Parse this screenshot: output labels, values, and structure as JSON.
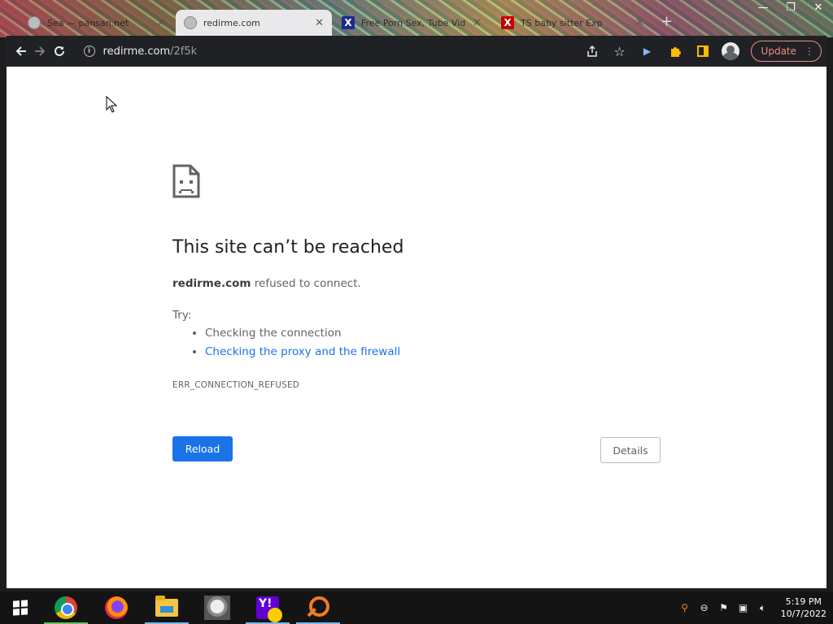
{
  "tabs": [
    {
      "label": "Sea — pansan.net",
      "active": false,
      "favicon": "globe-icon"
    },
    {
      "label": "redirme.com",
      "active": true,
      "favicon": "globe-icon"
    },
    {
      "label": "Free Porn Sex, Tube Vid",
      "active": false,
      "favicon": "x-site-icon",
      "favicon_color": "#1b2a8e"
    },
    {
      "label": "TS baby sitter Exp",
      "active": false,
      "favicon": "x-site-icon",
      "favicon_color": "#c40000"
    }
  ],
  "toolbar": {
    "address_domain": "redirme.com",
    "address_path": "/2f5k",
    "update_label": "Update"
  },
  "error": {
    "title": "This site can’t be reached",
    "host": "redirme.com",
    "description_suffix": " refused to connect.",
    "try_label": "Try:",
    "suggestions": [
      "Checking the connection",
      "Checking the proxy and the firewall"
    ],
    "code": "ERR_CONNECTION_REFUSED",
    "reload_label": "Reload",
    "details_label": "Details"
  },
  "taskbar": {
    "apps": [
      "chrome-icon",
      "firefox-icon",
      "file-explorer-icon",
      "photo-app-icon",
      "yahoo-icon",
      "search-app-icon"
    ],
    "time": "5:19 PM",
    "date": "10/7/2022"
  },
  "colors": {
    "accent": "#1a73e8",
    "update": "#f28b82",
    "toolbar": "#202124"
  }
}
